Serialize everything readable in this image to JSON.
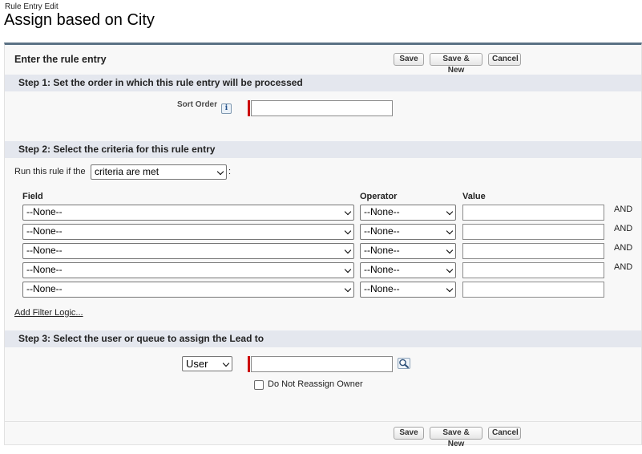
{
  "page": {
    "pretitle": "Rule Entry Edit",
    "title": "Assign based on City"
  },
  "panel": {
    "title": "Enter the rule entry",
    "buttons": {
      "save": "Save",
      "save_new": "Save & New",
      "cancel": "Cancel"
    }
  },
  "step1": {
    "header": "Step 1: Set the order in which this rule entry will be processed",
    "sort_order_label": "Sort Order",
    "info_icon": "i",
    "sort_order_value": ""
  },
  "step2": {
    "header": "Step 2: Select the criteria for this rule entry",
    "run_rule_label": "Run this rule if the",
    "criteria_select": "criteria are met",
    "colon": ":",
    "columns": {
      "field": "Field",
      "operator": "Operator",
      "value": "Value"
    },
    "rows": [
      {
        "field": "--None--",
        "operator": "--None--",
        "value": "",
        "conjunction": "AND"
      },
      {
        "field": "--None--",
        "operator": "--None--",
        "value": "",
        "conjunction": "AND"
      },
      {
        "field": "--None--",
        "operator": "--None--",
        "value": "",
        "conjunction": "AND"
      },
      {
        "field": "--None--",
        "operator": "--None--",
        "value": "",
        "conjunction": "AND"
      },
      {
        "field": "--None--",
        "operator": "--None--",
        "value": "",
        "conjunction": ""
      }
    ],
    "add_filter_logic": "Add Filter Logic..."
  },
  "step3": {
    "header": "Step 3: Select the user or queue to assign the Lead to",
    "assignee_type": "User",
    "assignee_value": "",
    "lookup_icon": "magnifier-lookup-icon",
    "do_not_reassign_label": "Do Not Reassign Owner",
    "do_not_reassign_checked": false
  },
  "colors": {
    "panel_top_border": "#5a7184",
    "section_header_bg": "#e4e7ee",
    "required_bar": "#cc0000"
  }
}
